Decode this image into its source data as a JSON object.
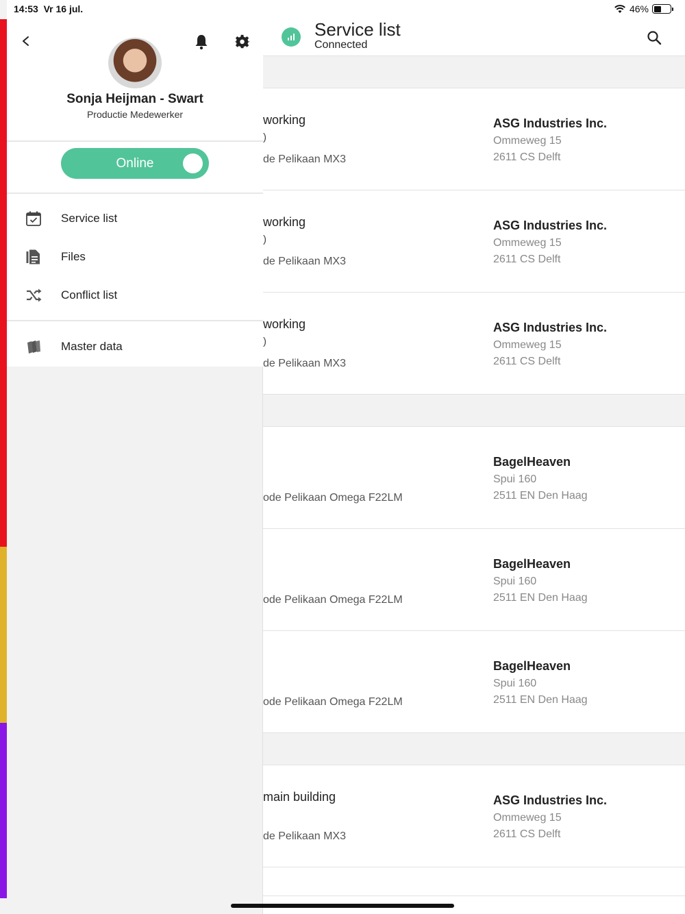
{
  "status_bar": {
    "time": "14:53",
    "date": "Vr 16 jul.",
    "battery": "46%",
    "battery_level": 0.46
  },
  "header": {
    "title": "Service list",
    "subtitle": "Connected"
  },
  "drawer": {
    "profile": {
      "name": "Sonja Heijman - Swart",
      "role": "Productie Medewerker"
    },
    "status_toggle": {
      "label": "Online",
      "on": true
    },
    "nav": [
      {
        "label": "Service list",
        "icon": "calendar-check-icon"
      },
      {
        "label": "Files",
        "icon": "file-icon"
      },
      {
        "label": "Conflict list",
        "icon": "shuffle-icon"
      },
      {
        "label": "Master data",
        "icon": "books-icon"
      }
    ],
    "accent_colors": [
      "#e8121f",
      "#e0b22b",
      "#8a16e6"
    ]
  },
  "rows": [
    {
      "title": "working",
      "sub": ")",
      "machine": "de Pelikaan MX3",
      "customer": "ASG Industries Inc.",
      "street": "Ommeweg 15",
      "city": "2611 CS Delft"
    },
    {
      "title": "working",
      "sub": ")",
      "machine": "de Pelikaan MX3",
      "customer": "ASG Industries Inc.",
      "street": "Ommeweg 15",
      "city": "2611 CS Delft"
    },
    {
      "title": "working",
      "sub": ")",
      "machine": "de Pelikaan MX3",
      "customer": "ASG Industries Inc.",
      "street": "Ommeweg 15",
      "city": "2611 CS Delft"
    },
    {
      "title": "",
      "sub": "",
      "machine": "ode Pelikaan Omega F22LM",
      "customer": "BagelHeaven",
      "street": "Spui 160",
      "city": "2511 EN Den Haag"
    },
    {
      "title": "",
      "sub": "",
      "machine": "ode Pelikaan Omega F22LM",
      "customer": "BagelHeaven",
      "street": "Spui 160",
      "city": "2511 EN Den Haag"
    },
    {
      "title": "",
      "sub": "",
      "machine": "ode Pelikaan Omega F22LM",
      "customer": "BagelHeaven",
      "street": "Spui 160",
      "city": "2511 EN Den Haag"
    },
    {
      "title": "main building",
      "sub": "",
      "machine": "de Pelikaan MX3",
      "customer": "ASG Industries Inc.",
      "street": "Ommeweg 15",
      "city": "2611 CS Delft"
    }
  ],
  "colors": {
    "accent_green": "#52c49a"
  }
}
